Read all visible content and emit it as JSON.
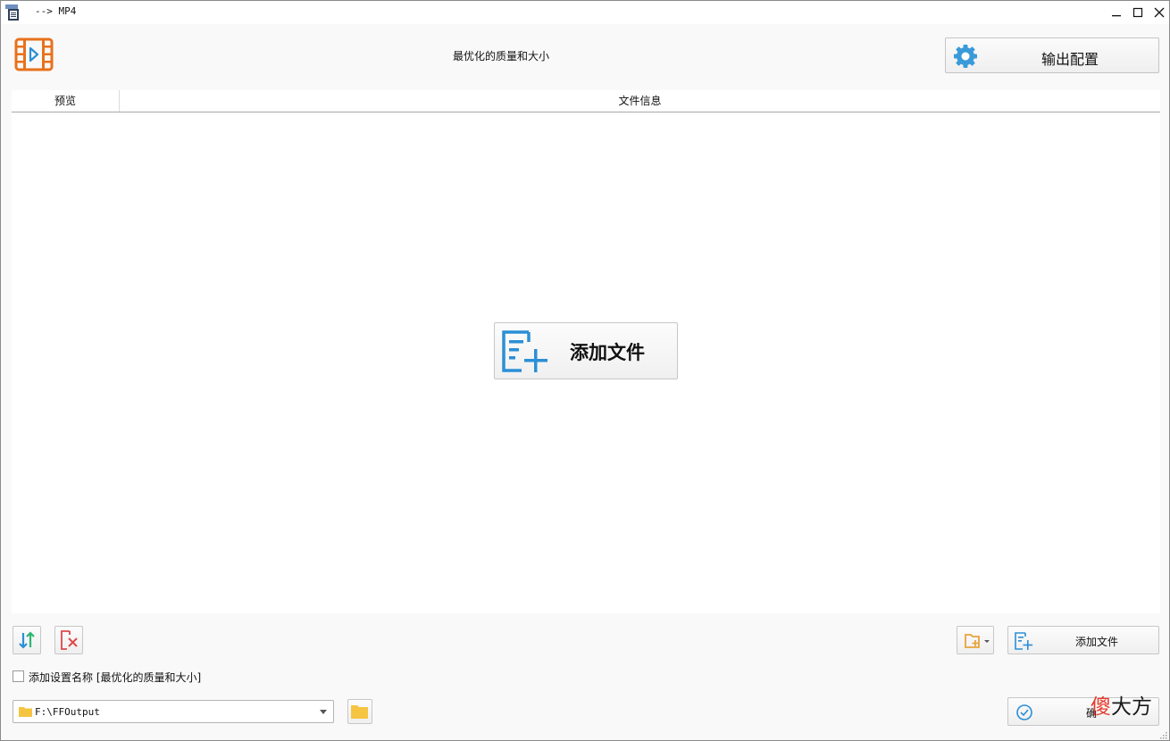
{
  "window": {
    "title": "--> MP4"
  },
  "header": {
    "preset_title": "最优化的质量和大小",
    "output_config_label": "输出配置"
  },
  "file_list": {
    "columns": [
      "预览",
      "文件信息"
    ],
    "center_add_label": "添加文件"
  },
  "toolbar": {
    "add_file_label": "添加文件"
  },
  "options": {
    "add_preset_name_label": "添加设置名称 [最优化的质量和大小]",
    "add_preset_name_checked": false
  },
  "output": {
    "folder_path": "F:\\FFOutput"
  },
  "actions": {
    "start_label_partial": "确"
  },
  "watermark": {
    "part1": "傻",
    "part2": "大方"
  },
  "colors": {
    "accent_blue": "#2b8fd6",
    "logo_orange": "#e8711c",
    "remove_red": "#e04848",
    "folder_yellow": "#f5c542"
  },
  "icons": {
    "app": "app-icon",
    "minimize": "minimize-icon",
    "maximize": "maximize-icon",
    "close": "close-icon",
    "logo": "video-film-icon",
    "gear": "gear-icon",
    "add_file": "add-file-icon",
    "sort": "sort-icon",
    "remove": "remove-file-icon",
    "add_folder": "add-folder-icon",
    "folder": "folder-icon",
    "start": "check-circle-icon"
  }
}
